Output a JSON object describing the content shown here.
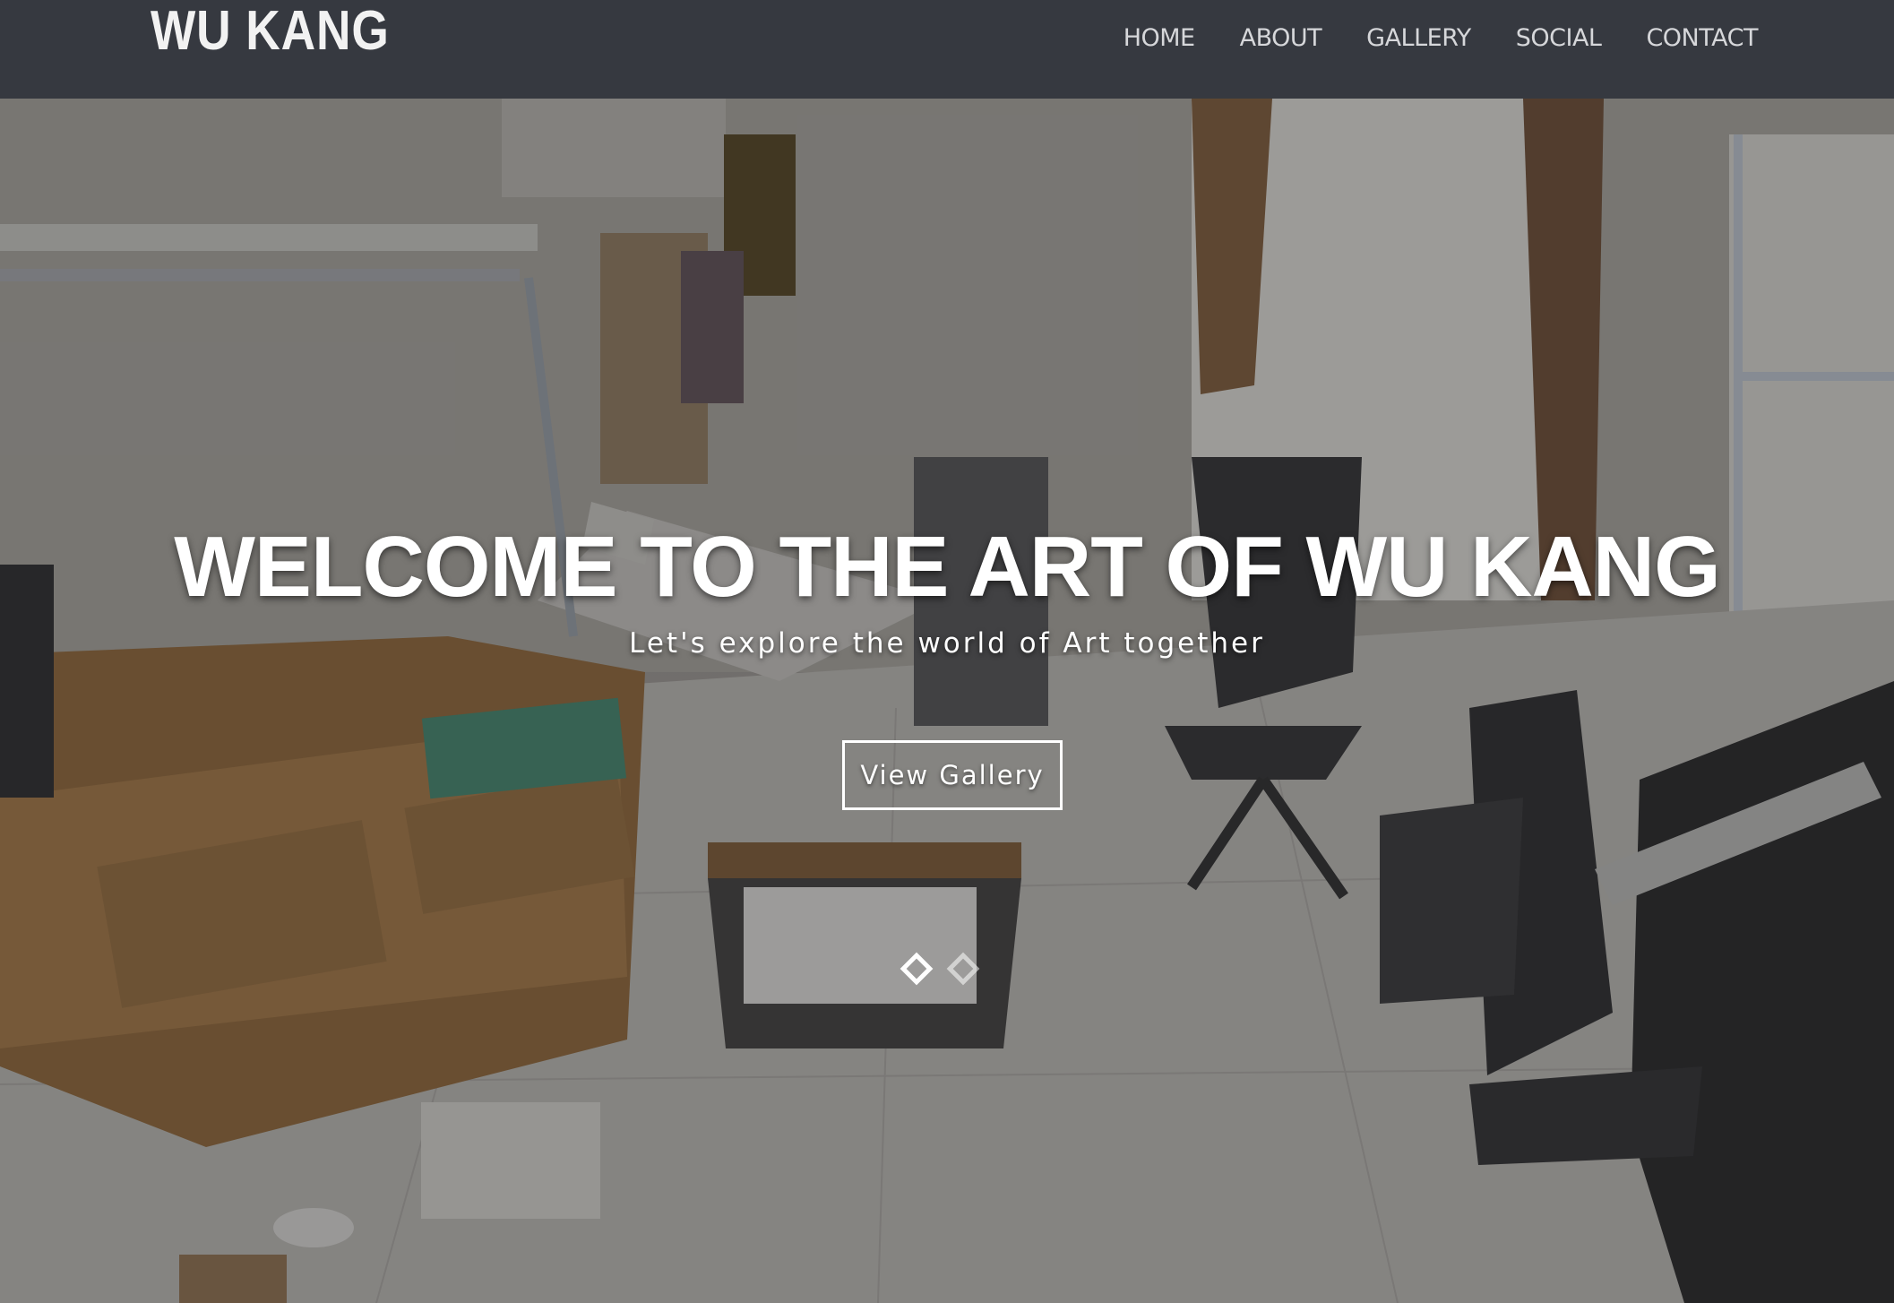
{
  "brand": {
    "name": "WU KANG"
  },
  "nav": {
    "items": [
      {
        "label": "HOME"
      },
      {
        "label": "ABOUT"
      },
      {
        "label": "GALLERY"
      },
      {
        "label": "SOCIAL"
      },
      {
        "label": "CONTACT"
      }
    ]
  },
  "hero": {
    "title": "WELCOME TO THE ART OF WU KANG",
    "subtitle": "Let's explore the world of Art together",
    "cta_label": "View Gallery",
    "slides": {
      "count": 2,
      "active": 1
    },
    "image_description_icon": "art-studio-photo"
  },
  "colors": {
    "navbar_bg": "#363940",
    "nav_text": "#d6d7da",
    "brand_text": "#f2f2f2",
    "hero_text": "#ffffff"
  }
}
